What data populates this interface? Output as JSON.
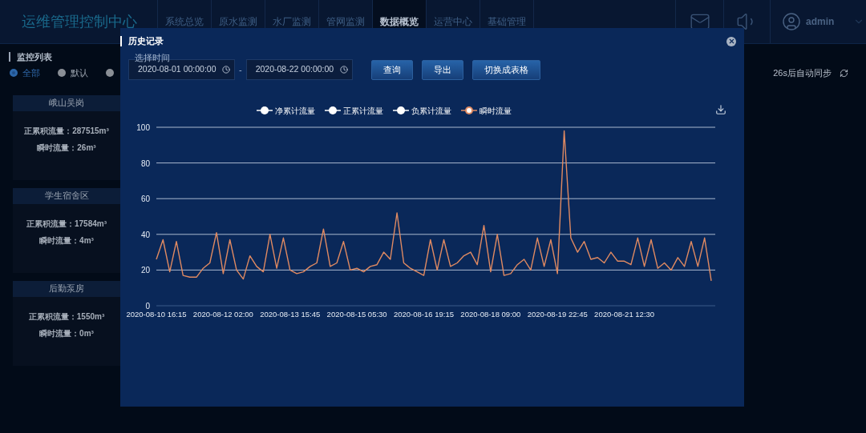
{
  "header": {
    "title": "运维管理控制中心",
    "nav": [
      {
        "label": "系统总览",
        "selected": false
      },
      {
        "label": "原水监测",
        "selected": false
      },
      {
        "label": "水厂监测",
        "selected": false
      },
      {
        "label": "管网监测",
        "selected": false
      },
      {
        "label": "数据概览",
        "selected": true
      },
      {
        "label": "运营中心",
        "selected": false
      },
      {
        "label": "基础管理",
        "selected": false
      }
    ],
    "user": {
      "name": "admin"
    }
  },
  "monitor": {
    "title": "监控列表",
    "filters": [
      {
        "label": "全部",
        "selected": true
      },
      {
        "label": "默认",
        "selected": false
      },
      {
        "selected": false
      }
    ],
    "sync_text": "26s后自动同步",
    "cards": [
      {
        "name": "峨山吴岗",
        "lines": [
          "正累积流量：287515m³",
          "瞬时流量：26m³"
        ]
      },
      {
        "name": "学生宿舍区",
        "lines": [
          "正累积流量：17584m³",
          "瞬时流量：4m³"
        ]
      },
      {
        "name": "后勤泵房",
        "lines": [
          "正累积流量：1550m³",
          "瞬时流量：0m³"
        ]
      }
    ]
  },
  "modal": {
    "title": "历史记录",
    "time_label": "选择时间",
    "start": "2020-08-01 00:00:00",
    "separator": "-",
    "end": "2020-08-22 00:00:00",
    "buttons": [
      "查询",
      "导出",
      "切换成表格"
    ],
    "chart_data": {
      "type": "line",
      "grid": true,
      "ylim": [
        0,
        100
      ],
      "yticks": [
        0,
        20,
        40,
        60,
        80,
        100
      ],
      "categories": [
        "2020-08-10 16:15",
        null,
        null,
        null,
        null,
        null,
        null,
        null,
        null,
        null,
        "2020-08-12 02:00",
        null,
        null,
        null,
        null,
        null,
        null,
        null,
        null,
        null,
        "2020-08-13 15:45",
        null,
        null,
        null,
        null,
        null,
        null,
        null,
        null,
        null,
        "2020-08-15 05:30",
        null,
        null,
        null,
        null,
        null,
        null,
        null,
        null,
        null,
        "2020-08-16 19:15",
        null,
        null,
        null,
        null,
        null,
        null,
        null,
        null,
        null,
        "2020-08-18 09:00",
        null,
        null,
        null,
        null,
        null,
        null,
        null,
        null,
        null,
        "2020-08-19 22:45",
        null,
        null,
        null,
        null,
        null,
        null,
        null,
        null,
        null,
        "2020-08-21 12:30",
        null,
        null,
        null,
        null,
        null,
        null,
        null,
        null,
        null,
        null,
        null,
        null,
        null
      ],
      "series": [
        {
          "name": "净累计流量",
          "color": "#ffffff",
          "values": [
            null,
            null,
            null,
            null,
            null,
            null,
            null,
            null,
            null,
            null,
            null,
            null,
            null,
            null,
            null,
            null,
            null,
            null,
            null,
            null,
            null,
            null,
            null,
            null,
            null,
            null,
            null,
            null,
            null,
            null,
            null,
            null,
            null,
            null,
            null,
            null,
            null,
            null,
            null,
            null,
            null,
            null,
            null,
            null,
            null,
            null,
            null,
            null,
            null,
            null,
            null,
            null,
            null,
            null,
            null,
            null,
            null,
            null,
            null,
            null,
            null,
            null,
            null,
            null,
            null,
            null,
            null,
            null,
            null,
            null,
            null,
            null,
            null,
            null,
            null,
            null,
            null,
            null,
            null,
            null,
            null,
            null,
            null,
            null
          ]
        },
        {
          "name": "正累计流量",
          "color": "#ffffff",
          "values": [
            null,
            null,
            null,
            null,
            null,
            null,
            null,
            null,
            null,
            null,
            null,
            null,
            null,
            null,
            null,
            null,
            null,
            null,
            null,
            null,
            null,
            null,
            null,
            null,
            null,
            null,
            null,
            null,
            null,
            null,
            null,
            null,
            null,
            null,
            null,
            null,
            null,
            null,
            null,
            null,
            null,
            null,
            null,
            null,
            null,
            null,
            null,
            null,
            null,
            null,
            null,
            null,
            null,
            null,
            null,
            null,
            null,
            null,
            null,
            null,
            null,
            null,
            null,
            null,
            null,
            null,
            null,
            null,
            null,
            null,
            null,
            null,
            null,
            null,
            null,
            null,
            null,
            null,
            null,
            null,
            null,
            null,
            null,
            null
          ]
        },
        {
          "name": "负累计流量",
          "color": "#ffffff",
          "values": [
            null,
            null,
            null,
            null,
            null,
            null,
            null,
            null,
            null,
            null,
            null,
            null,
            null,
            null,
            null,
            null,
            null,
            null,
            null,
            null,
            null,
            null,
            null,
            null,
            null,
            null,
            null,
            null,
            null,
            null,
            null,
            null,
            null,
            null,
            null,
            null,
            null,
            null,
            null,
            null,
            null,
            null,
            null,
            null,
            null,
            null,
            null,
            null,
            null,
            null,
            null,
            null,
            null,
            null,
            null,
            null,
            null,
            null,
            null,
            null,
            null,
            null,
            null,
            null,
            null,
            null,
            null,
            null,
            null,
            null,
            null,
            null,
            null,
            null,
            null,
            null,
            null,
            null,
            null,
            null,
            null,
            null,
            null,
            null
          ]
        },
        {
          "name": "瞬时流量",
          "color": "#e08a62",
          "values": [
            26,
            37,
            19,
            36,
            17,
            16,
            16,
            21,
            24,
            41,
            18,
            37,
            20,
            15,
            28,
            22,
            19,
            40,
            21,
            38,
            20,
            18,
            19,
            22,
            24,
            43,
            22,
            24,
            36,
            20,
            21,
            19,
            22,
            23,
            30,
            26,
            52,
            24,
            21,
            19,
            17,
            37,
            20,
            37,
            22,
            24,
            28,
            30,
            23,
            45,
            19,
            40,
            17,
            18,
            23,
            26,
            20,
            38,
            22,
            37,
            18,
            98,
            38,
            30,
            36,
            26,
            27,
            24,
            30,
            25,
            25,
            23,
            38,
            22,
            37,
            21,
            24,
            20,
            27,
            22,
            36,
            22,
            38,
            14
          ]
        }
      ]
    }
  }
}
